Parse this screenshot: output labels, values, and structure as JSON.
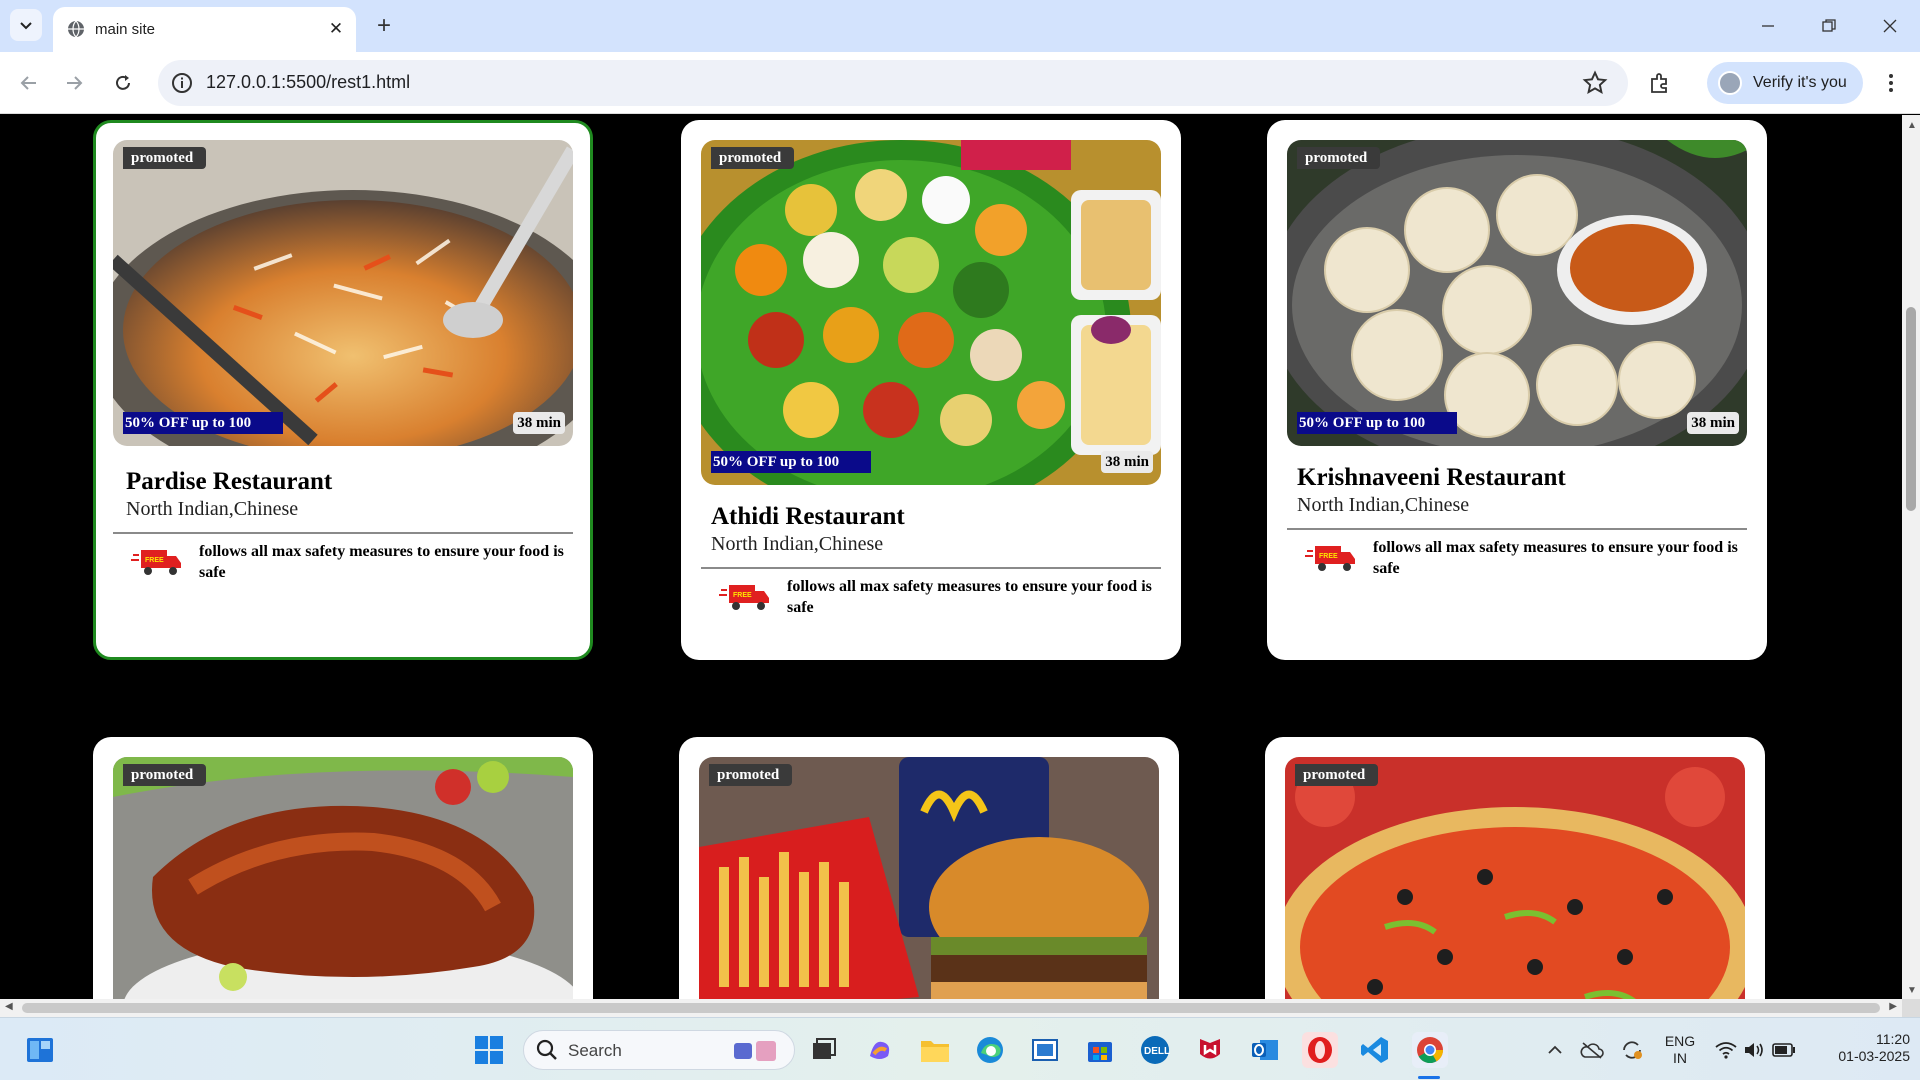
{
  "browser": {
    "tab_title": "main site",
    "url": "127.0.0.1:5500/rest1.html",
    "profile_label": "Verify it's you"
  },
  "cards": [
    {
      "badge": "promoted",
      "offer": "50% OFF up to 100",
      "time": "38 min",
      "name": "Pardise Restaurant",
      "cuisine": "North Indian,Chinese",
      "safety": "follows all max safety measures to ensure your food is safe"
    },
    {
      "badge": "promoted",
      "offer": "50% OFF up to 100",
      "time": "38 min",
      "name": "Athidi Restaurant",
      "cuisine": "North Indian,Chinese",
      "safety": "follows all max safety measures to ensure your food is safe"
    },
    {
      "badge": "promoted",
      "offer": "50% OFF up to 100",
      "time": "38 min",
      "name": "Krishnaveeni Restaurant",
      "cuisine": "North Indian,Chinese",
      "safety": "follows all max safety measures to ensure your food is safe"
    },
    {
      "badge": "promoted"
    },
    {
      "badge": "promoted"
    },
    {
      "badge": "promoted"
    }
  ],
  "taskbar": {
    "search_placeholder": "Search",
    "lang_line1": "ENG",
    "lang_line2": "IN",
    "time": "11:20",
    "date": "01-03-2025"
  },
  "icons": [
    "chevron-down-icon",
    "globe-icon",
    "close-icon",
    "plus-icon",
    "minimize-icon",
    "restore-icon",
    "window-close-icon",
    "back-icon",
    "forward-icon",
    "reload-icon",
    "site-info-icon",
    "star-icon",
    "extensions-icon",
    "avatar",
    "more-icon",
    "delivery-truck-icon",
    "windows-start-icon",
    "search-icon",
    "task-view-icon",
    "copilot-icon",
    "file-explorer-icon",
    "edge-icon",
    "store-icon",
    "dell-icon",
    "mcafee-icon",
    "outlook-icon",
    "opera-icon",
    "vscode-icon",
    "chrome-icon",
    "wifi-icon",
    "volume-icon",
    "battery-icon"
  ]
}
